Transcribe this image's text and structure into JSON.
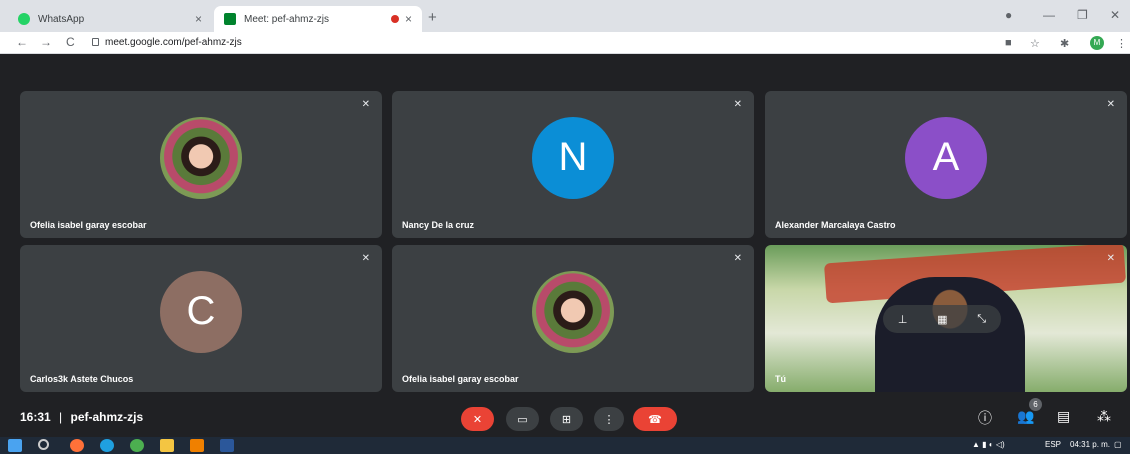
{
  "browser": {
    "tabs": [
      {
        "title": "WhatsApp",
        "close": "×",
        "favicon_color": "#25d366"
      },
      {
        "title": "Meet: pef-ahmz-zjs",
        "close": "×",
        "favicon_color": "#00832d"
      }
    ],
    "new_tab": "+",
    "url": "meet.google.com/pef-ahmz-zjs",
    "profile_initial": "M"
  },
  "participants": [
    {
      "name": "Ofelia isabel garay escobar",
      "kind": "photo"
    },
    {
      "name": "Nancy De la cruz",
      "initial": "N",
      "color": "#0b8ed6"
    },
    {
      "name": "Alexander Marcalaya Castro",
      "initial": "A",
      "color": "#8b4fc8"
    },
    {
      "name": "Carlos3k Astete Chucos",
      "initial": "C",
      "color": "#8d6e63"
    },
    {
      "name": "Ofelia isabel garay escobar",
      "kind": "photo"
    },
    {
      "name": "Tú",
      "kind": "self"
    }
  ],
  "bottom": {
    "time": "16:31",
    "separator": "|",
    "meeting_code": "pef-ahmz-zjs",
    "participant_count": "6"
  },
  "colors": {
    "end_call": "#ea4335",
    "mic_off": "#ea4335",
    "control": "#3c4043"
  },
  "taskbar": {
    "lang": "ESP",
    "clock": "04:31 p. m."
  }
}
